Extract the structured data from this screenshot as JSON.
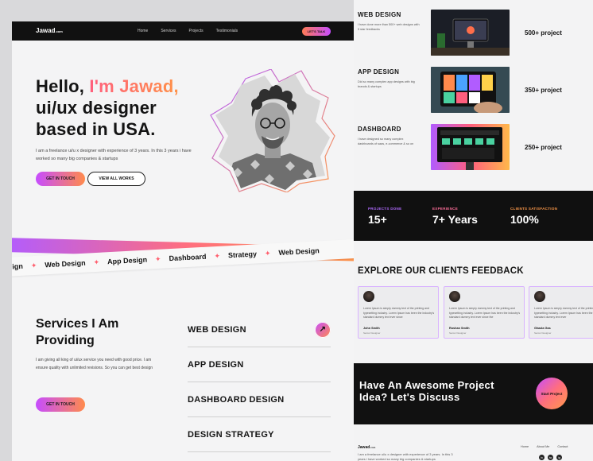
{
  "nav": {
    "logo": "Jawad",
    "logo_suffix": ".com",
    "links": [
      "Home",
      "Services",
      "Projects",
      "Testimonials"
    ],
    "cta_label": "LET'S TALK"
  },
  "hero": {
    "line1_prefix": "Hello, ",
    "line1_accent": "I'm Jawad,",
    "line2": "ui/ux designer",
    "line3": "based in USA.",
    "description": "I am a freelance ui/u x designer with experience of 3 years. In this 3 years i have worked so many big companies & startups",
    "primary_button": "GET IN TOUCH",
    "secondary_button": "VIEW ALL WORKS"
  },
  "ticker": {
    "items": [
      "asign",
      "Web Design",
      "App Design",
      "Dashboard",
      "Strategy",
      "Web Design"
    ]
  },
  "services": {
    "title_line1": "Services I Am",
    "title_line2": "Providing",
    "description": "I am giving all king of ui/ux service you need with good price. I am ensure quality with unlimited revisions. So you can get best design",
    "button": "GET IN TOUCH",
    "items": [
      "WEB DESIGN",
      "APP DESIGN",
      "DASHBOARD DESIGN",
      "DESIGN STRATEGY"
    ]
  },
  "projects": [
    {
      "title": "WEB DESIGN",
      "desc": "I have done more than 500+ web designs with 5 star feedbacks",
      "count": "500+ project"
    },
    {
      "title": "APP DESIGN",
      "desc": "Did so many complex app designs with big brands & startups",
      "count": "350+ project"
    },
    {
      "title": "DASHBOARD",
      "desc": "I have designed so many complex dashboards of saas, e-commerce & so on",
      "count": "250+ project"
    }
  ],
  "stats": [
    {
      "label": "PROJECTS DONE",
      "value": "15+",
      "color": "#b06bff"
    },
    {
      "label": "EXPERIENCE",
      "value": "7+ Years",
      "color": "#ff6e9a"
    },
    {
      "label": "CLIENTS SATISFACTION",
      "value": "100%",
      "color": "#ff9a4a"
    }
  ],
  "feedback": {
    "title": "EXPLORE OUR CLIENTS FEEDBACK",
    "cards": [
      {
        "quote": "Lorem Ipsum is simply dummy text of the printing and typesetting industry. Lorem Ipsum has been the industry's standard dummy text ever since",
        "name": "John Smith",
        "role": "Senior Designer"
      },
      {
        "quote": "Lorem Ipsum is simply dummy text of the printing and typesetting industry. Lorem Ipsum has been the industry's standard dummy text ever since the",
        "name": "Roshan Smith",
        "role": "Senior Designer"
      },
      {
        "quote": "Lorem Ipsum is simply dummy text of the printing and typesetting industry. Lorem Ipsum has been the industry's standard dummy text ever",
        "name": "Ghazla Gas",
        "role": "Senior Designer"
      }
    ]
  },
  "cta": {
    "line1": "Have An Awesome Project",
    "line2": "Idea? Let's Discuss",
    "button": "Start Project"
  },
  "footer": {
    "logo": "Jawad",
    "logo_suffix": ".com",
    "text": "I am a freelance ui/u x designer with experience of 3 years. In this 3 years i have worked so many big companies & startups",
    "links": [
      "Home",
      "About Me",
      "Contact"
    ],
    "socials": [
      "in",
      "tw",
      "ig"
    ]
  },
  "colors": {
    "purple": "#c64dff",
    "orange": "#ff8a4c",
    "pink": "#ff5f7e",
    "dark": "#111111"
  }
}
